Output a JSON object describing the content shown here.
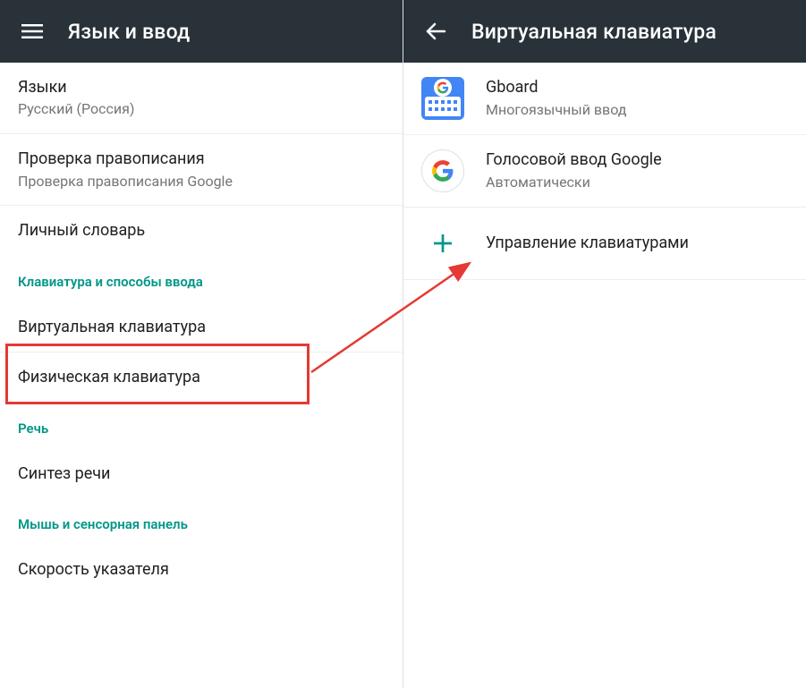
{
  "left": {
    "title": "Язык и ввод",
    "items": {
      "languages": {
        "primary": "Языки",
        "secondary": "Русский (Россия)"
      },
      "spellcheck": {
        "primary": "Проверка правописания",
        "secondary": "Проверка правописания Google"
      },
      "personal_dict": {
        "primary": "Личный словарь"
      },
      "section_keyboard": "Клавиатура и способы ввода",
      "virtual_kb": {
        "primary": "Виртуальная клавиатура"
      },
      "physical_kb": {
        "primary": "Физическая клавиатура"
      },
      "section_speech": "Речь",
      "tts": {
        "primary": "Синтез речи"
      },
      "section_mouse": "Мышь и сенсорная панель",
      "pointer_speed": {
        "primary": "Скорость указателя"
      }
    }
  },
  "right": {
    "title": "Виртуальная клавиатура",
    "items": {
      "gboard": {
        "primary": "Gboard",
        "secondary": "Многоязычный ввод"
      },
      "voice": {
        "primary": "Голосовой ввод Google",
        "secondary": "Автоматически"
      },
      "manage": {
        "primary": "Управление клавиатурами"
      }
    }
  },
  "colors": {
    "accent": "#009688",
    "highlight": "#e53935",
    "appbar": "#283238"
  }
}
